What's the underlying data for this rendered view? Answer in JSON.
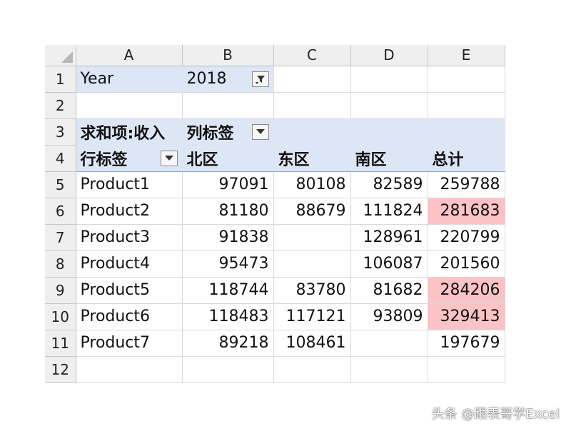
{
  "columns": [
    "A",
    "B",
    "C",
    "D",
    "E"
  ],
  "rows": [
    "1",
    "2",
    "3",
    "4",
    "5",
    "6",
    "7",
    "8",
    "9",
    "10",
    "11",
    "12"
  ],
  "filter": {
    "label": "Year",
    "value": "2018",
    "icon": "filter-funnel-icon"
  },
  "pivot": {
    "value_label": "求和项:收入",
    "col_label": "列标签",
    "row_label": "行标签",
    "headers": [
      "北区",
      "东区",
      "南区",
      "总计"
    ],
    "data": [
      {
        "name": "Product1",
        "v": [
          "97091",
          "80108",
          "82589",
          "259788"
        ]
      },
      {
        "name": "Product2",
        "v": [
          "81180",
          "88679",
          "111824",
          "281683"
        ]
      },
      {
        "name": "Product3",
        "v": [
          "91838",
          "",
          "128961",
          "220799"
        ]
      },
      {
        "name": "Product4",
        "v": [
          "95473",
          "",
          "106087",
          "201560"
        ]
      },
      {
        "name": "Product5",
        "v": [
          "118744",
          "83780",
          "81682",
          "284206"
        ]
      },
      {
        "name": "Product6",
        "v": [
          "118483",
          "117121",
          "93809",
          "329413"
        ]
      },
      {
        "name": "Product7",
        "v": [
          "89218",
          "108461",
          "",
          "197679"
        ]
      }
    ]
  },
  "highlight": {
    "color": "#fbc3c5",
    "text_color": "#c0141b"
  },
  "watermark": "头条 @跟表哥学Excel"
}
